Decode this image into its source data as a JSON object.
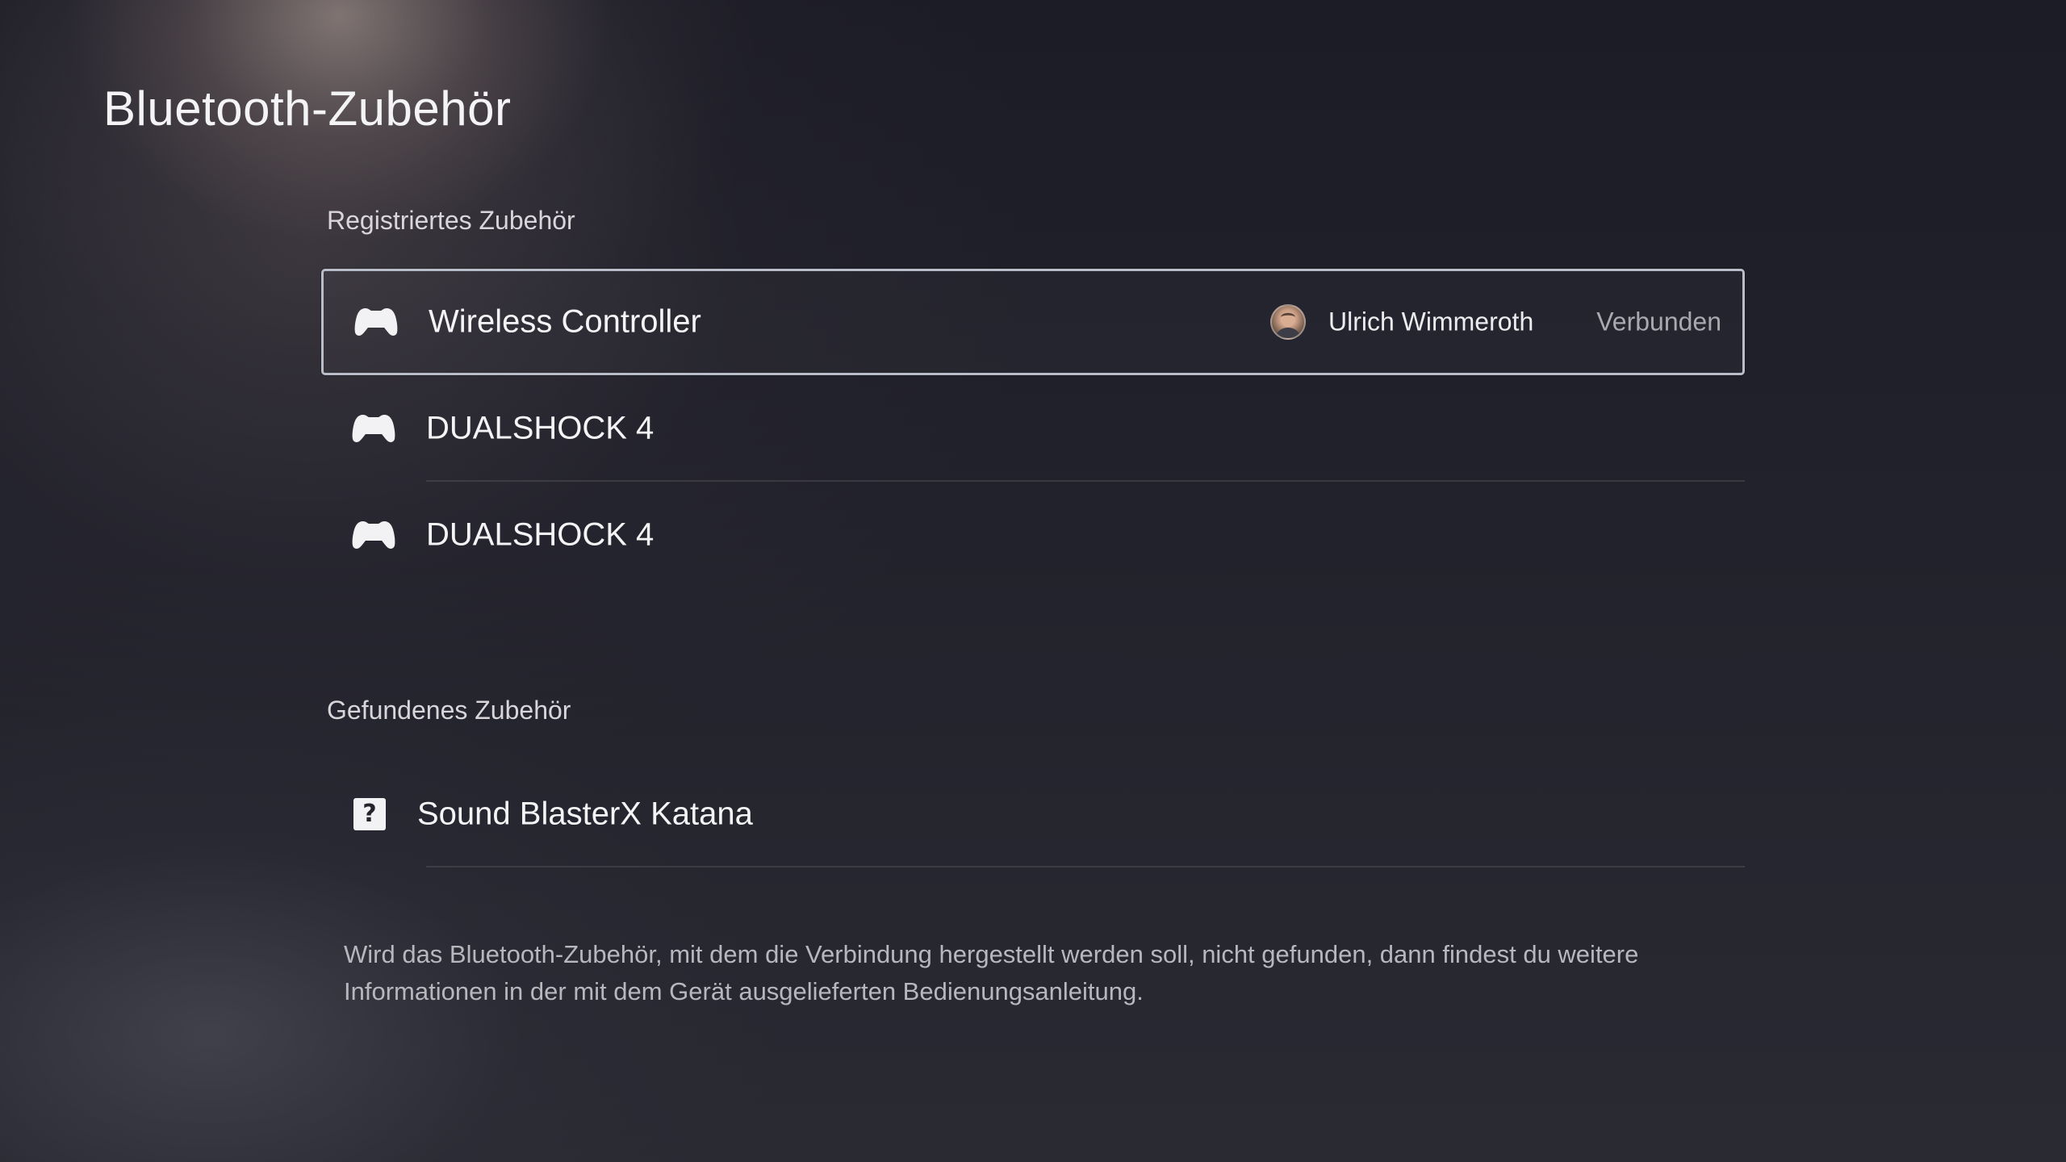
{
  "page": {
    "title": "Bluetooth-Zubehör"
  },
  "registered": {
    "header": "Registriertes Zubehör",
    "items": [
      {
        "icon": "gamepad-icon",
        "label": "Wireless Controller",
        "user_name": "Ulrich Wimmeroth",
        "status": "Verbunden",
        "focused": true
      },
      {
        "icon": "gamepad-icon",
        "label": "DUALSHOCK 4"
      },
      {
        "icon": "gamepad-icon",
        "label": "DUALSHOCK 4"
      }
    ]
  },
  "found": {
    "header": "Gefundenes Zubehör",
    "items": [
      {
        "icon": "unknown-device-icon",
        "icon_glyph": "?",
        "label": "Sound BlasterX Katana"
      }
    ]
  },
  "hint": {
    "text": "Wird das Bluetooth-Zubehör, mit dem die Verbindung hergestellt werden soll, nicht gefunden, dann findest du weitere Informationen in der mit dem Gerät ausgelieferten Bedienungsanleitung."
  },
  "colors": {
    "focus_border": "#b9bdc9",
    "text_primary": "#f4f4f6",
    "text_secondary": "#a9a9b0",
    "background": "#22222c"
  }
}
